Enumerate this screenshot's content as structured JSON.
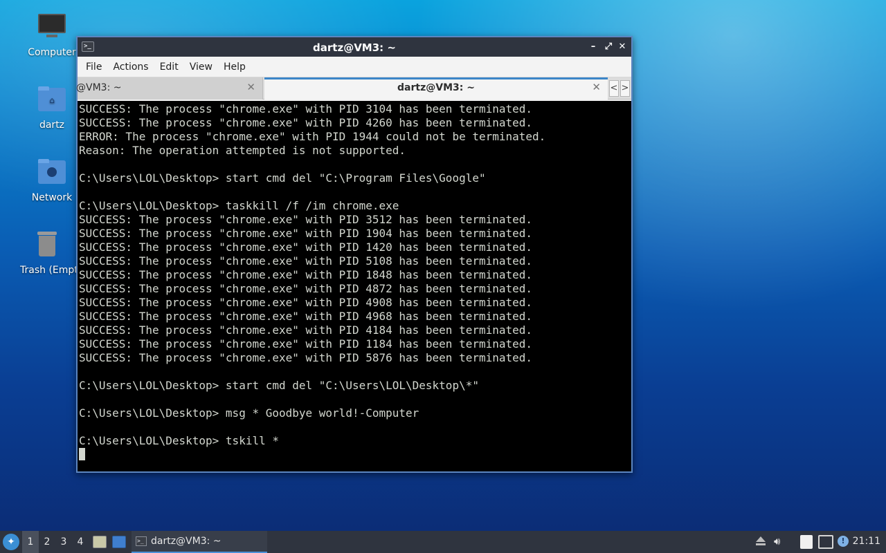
{
  "desktop": {
    "icons": [
      {
        "label": "Computer"
      },
      {
        "label": "dartz"
      },
      {
        "label": "Network"
      },
      {
        "label": "Trash (Empt"
      }
    ]
  },
  "window": {
    "title": "dartz@VM3: ~",
    "controls": {
      "minimize": "–",
      "maximize": "⤢",
      "close": "✕"
    },
    "menu": [
      "File",
      "Actions",
      "Edit",
      "View",
      "Help"
    ],
    "tabs": [
      {
        "label": "@VM3: ~",
        "close": "✕",
        "active": false
      },
      {
        "label": "dartz@VM3: ~",
        "close": "✕",
        "active": true
      }
    ],
    "tab_scroll": {
      "left": "<",
      "right": ">"
    }
  },
  "terminal": {
    "lines": [
      "SUCCESS: The process \"chrome.exe\" with PID 3104 has been terminated.",
      "SUCCESS: The process \"chrome.exe\" with PID 4260 has been terminated.",
      "ERROR: The process \"chrome.exe\" with PID 1944 could not be terminated.",
      "Reason: The operation attempted is not supported.",
      "",
      "C:\\Users\\LOL\\Desktop> start cmd del \"C:\\Program Files\\Google\"",
      "",
      "C:\\Users\\LOL\\Desktop> taskkill /f /im chrome.exe",
      "SUCCESS: The process \"chrome.exe\" with PID 3512 has been terminated.",
      "SUCCESS: The process \"chrome.exe\" with PID 1904 has been terminated.",
      "SUCCESS: The process \"chrome.exe\" with PID 1420 has been terminated.",
      "SUCCESS: The process \"chrome.exe\" with PID 5108 has been terminated.",
      "SUCCESS: The process \"chrome.exe\" with PID 1848 has been terminated.",
      "SUCCESS: The process \"chrome.exe\" with PID 4872 has been terminated.",
      "SUCCESS: The process \"chrome.exe\" with PID 4908 has been terminated.",
      "SUCCESS: The process \"chrome.exe\" with PID 4968 has been terminated.",
      "SUCCESS: The process \"chrome.exe\" with PID 4184 has been terminated.",
      "SUCCESS: The process \"chrome.exe\" with PID 1184 has been terminated.",
      "SUCCESS: The process \"chrome.exe\" with PID 5876 has been terminated.",
      "",
      "C:\\Users\\LOL\\Desktop> start cmd del \"C:\\Users\\LOL\\Desktop\\*\"",
      "",
      "C:\\Users\\LOL\\Desktop> msg * Goodbye world!-Computer",
      "",
      "C:\\Users\\LOL\\Desktop> tskill *"
    ],
    "colors": {
      "background": "#000000",
      "foreground": "#d3d7cf"
    }
  },
  "taskbar": {
    "workspaces": [
      "1",
      "2",
      "3",
      "4"
    ],
    "active_workspace": "1",
    "task_label": "dartz@VM3: ~",
    "clock": "21:11",
    "tray_icons": [
      "eject-icon",
      "volume-icon",
      "clipboard-icon",
      "network-icon",
      "notification-icon"
    ]
  },
  "theme": {
    "accent": "#4a90d9",
    "panel": "#2f343f"
  }
}
